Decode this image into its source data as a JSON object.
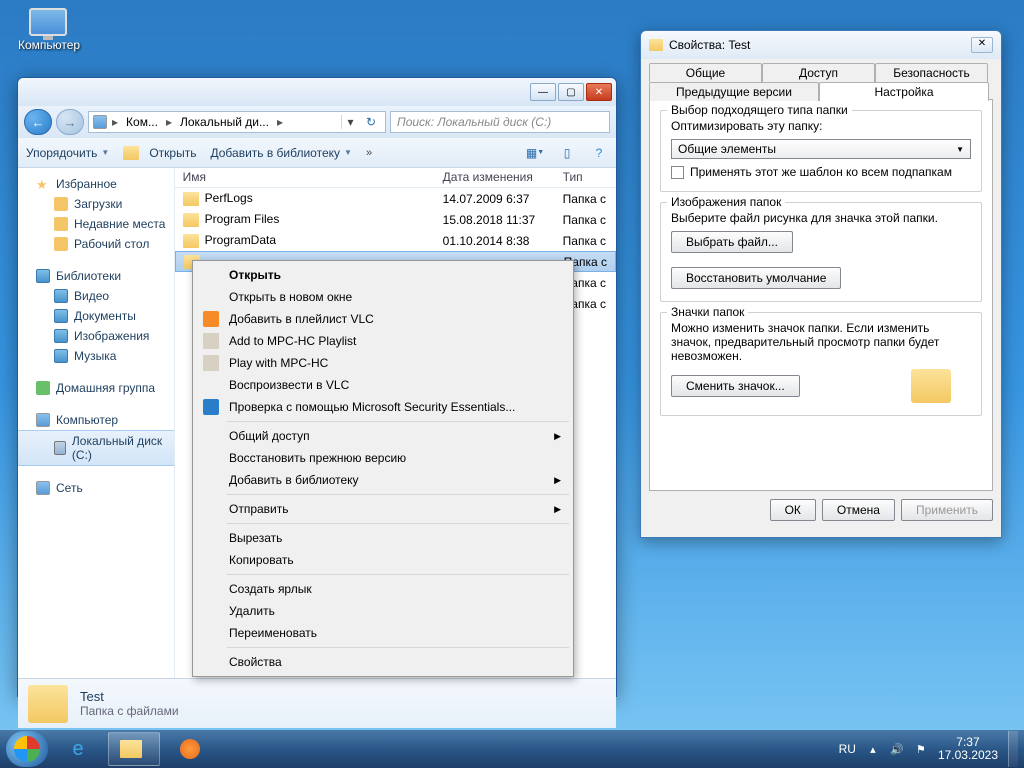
{
  "desktop": {
    "computer_label": "Компьютер"
  },
  "explorer": {
    "breadcrumb": {
      "p1": "Ком...",
      "p2": "Локальный ди..."
    },
    "search_placeholder": "Поиск: Локальный диск (C:)",
    "toolbar": {
      "organize": "Упорядочить",
      "open": "Открыть",
      "addlib": "Добавить в библиотеку",
      "more": "»"
    },
    "navpane": {
      "favorites": "Избранное",
      "downloads": "Загрузки",
      "recent": "Недавние места",
      "desktop": "Рабочий стол",
      "libraries": "Библиотеки",
      "video": "Видео",
      "documents": "Документы",
      "pictures": "Изображения",
      "music": "Музыка",
      "homegroup": "Домашняя группа",
      "computer": "Компьютер",
      "localdisk": "Локальный диск (C:)",
      "network": "Сеть"
    },
    "cols": {
      "name": "Имя",
      "date": "Дата изменения",
      "type": "Тип"
    },
    "rows": [
      {
        "name": "PerfLogs",
        "date": "14.07.2009 6:37",
        "type": "Папка с"
      },
      {
        "name": "Program Files",
        "date": "15.08.2018 11:37",
        "type": "Папка с"
      },
      {
        "name": "ProgramData",
        "date": "01.10.2014 8:38",
        "type": "Папка с"
      },
      {
        "name": "",
        "date": "",
        "type": "Папка с"
      },
      {
        "name": "",
        "date": "",
        "type": "Папка с"
      },
      {
        "name": "",
        "date": "",
        "type": "Папка с"
      }
    ],
    "details": {
      "title": "Test",
      "sub": "Папка с файлами"
    }
  },
  "ctx": {
    "open": "Открыть",
    "open_new": "Открыть в новом окне",
    "vlc_add": "Добавить в плейлист VLC",
    "mpc_add": "Add to MPC-HC Playlist",
    "mpc_play": "Play with MPC-HC",
    "vlc_play": "Воспроизвести в VLC",
    "mse": "Проверка с помощью Microsoft Security Essentials...",
    "share": "Общий доступ",
    "restore": "Восстановить прежнюю версию",
    "addlib": "Добавить в библиотеку",
    "sendto": "Отправить",
    "cut": "Вырезать",
    "copy": "Копировать",
    "shortcut": "Создать ярлык",
    "delete": "Удалить",
    "rename": "Переименовать",
    "props": "Свойства"
  },
  "props": {
    "title": "Свойства: Test",
    "tabs": {
      "general": "Общие",
      "sharing": "Доступ",
      "security": "Безопасность",
      "prev": "Предыдущие версии",
      "customize": "Настройка"
    },
    "ft": {
      "legend": "Выбор подходящего типа папки",
      "optimize": "Оптимизировать эту папку:",
      "combo": "Общие элементы",
      "applysub": "Применять этот же шаблон ко всем подпапкам"
    },
    "img": {
      "legend": "Изображения папок",
      "pick_text": "Выберите файл рисунка для значка этой папки.",
      "choose": "Выбрать файл...",
      "restore": "Восстановить умолчание"
    },
    "ico": {
      "legend": "Значки папок",
      "text": "Можно изменить значок папки. Если изменить значок, предварительный просмотр папки будет невозможен.",
      "change": "Сменить значок..."
    },
    "ok": "ОК",
    "cancel": "Отмена",
    "apply": "Применить"
  },
  "taskbar": {
    "lang": "RU",
    "time": "7:37",
    "date": "17.03.2023"
  }
}
